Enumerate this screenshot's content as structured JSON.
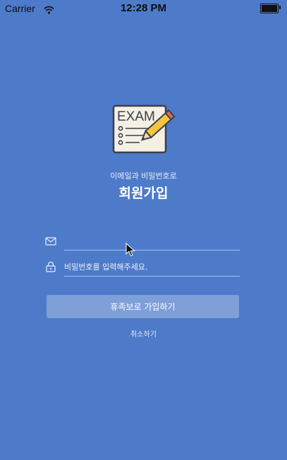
{
  "status_bar": {
    "carrier": "Carrier",
    "time": "12:28 PM"
  },
  "logo": {
    "text": "EXAM",
    "icon": "exam-checklist-pencil-icon"
  },
  "header": {
    "subtitle": "이메일과 비밀번호로",
    "title": "회원가입"
  },
  "form": {
    "email": {
      "value": "",
      "placeholder": "",
      "icon": "mail-icon"
    },
    "password": {
      "value": "",
      "placeholder": "비밀번호를 입력해주세요.",
      "icon": "lock-icon"
    },
    "submit_label": "휴족보로 가입하기",
    "cancel_label": "취소하기"
  },
  "colors": {
    "background": "#4d7bca",
    "button": "rgba(255,255,255,0.28)",
    "text": "#ffffff"
  }
}
